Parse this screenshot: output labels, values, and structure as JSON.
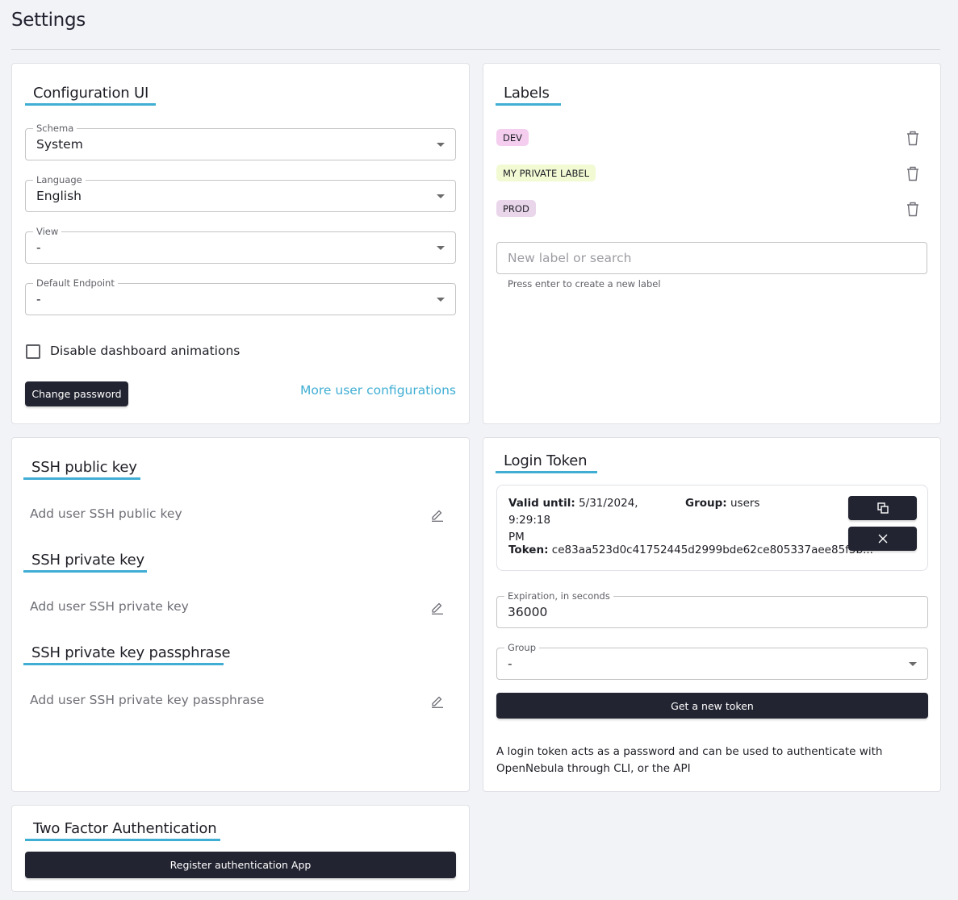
{
  "page": {
    "title": "Settings"
  },
  "config_ui": {
    "title": "Configuration UI",
    "schema": {
      "label": "Schema",
      "value": "System"
    },
    "language": {
      "label": "Language",
      "value": "English"
    },
    "view": {
      "label": "View",
      "value": "-"
    },
    "default_endpoint": {
      "label": "Default Endpoint",
      "value": "-"
    },
    "disable_animations": {
      "label": "Disable dashboard animations",
      "checked": false
    },
    "change_password_label": "Change password",
    "more_configs_label": "More user configurations"
  },
  "labels": {
    "title": "Labels",
    "items": [
      {
        "name": "DEV",
        "color": "#f4cdef"
      },
      {
        "name": "MY PRIVATE LABEL",
        "color": "#f1fad3"
      },
      {
        "name": "PROD",
        "color": "#ead6ea"
      }
    ],
    "input_placeholder": "New label or search",
    "helper": "Press enter to create a new label"
  },
  "ssh": {
    "public_key": {
      "title": "SSH public key",
      "placeholder": "Add user SSH public key"
    },
    "private_key": {
      "title": "SSH private key",
      "placeholder": "Add user SSH private key"
    },
    "passphrase": {
      "title": "SSH private key passphrase",
      "placeholder": "Add user SSH private key passphrase"
    }
  },
  "login_token": {
    "title": "Login Token",
    "valid_until_label": "Valid until:",
    "valid_until_value": "5/31/2024, 9:29:18",
    "valid_until_suffix": "PM",
    "group_label": "Group:",
    "group_value": "users",
    "token_label": "Token:",
    "token_value": "ce83aa523d0c41752445d2999bde62ce805337aee85f5b...",
    "expiration": {
      "label": "Expiration, in seconds",
      "value": "36000"
    },
    "group_select": {
      "label": "Group",
      "value": "-"
    },
    "get_token_label": "Get a new token",
    "description": "A login token acts as a password and can be used to authenticate with OpenNebula through CLI, or the API"
  },
  "two_factor": {
    "title": "Two Factor Authentication",
    "register_label": "Register authentication App"
  },
  "colors": {
    "accent": "#40aed3",
    "button_dark": "#222431",
    "background": "#f2f3f7"
  }
}
